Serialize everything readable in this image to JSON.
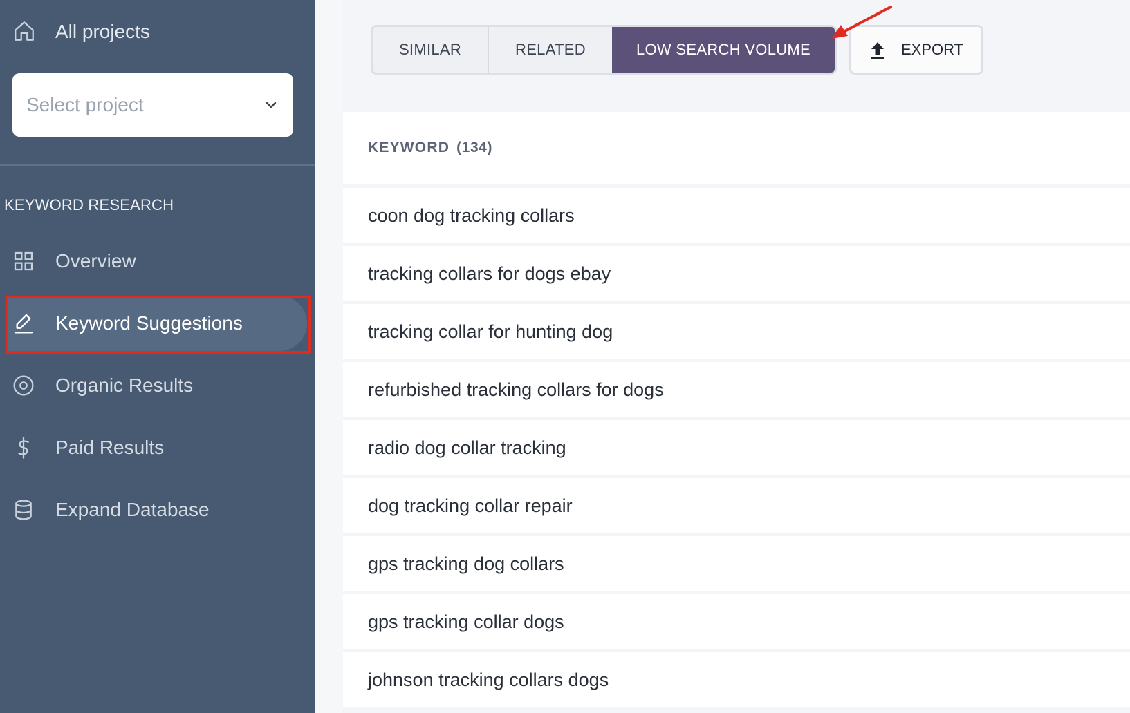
{
  "sidebar": {
    "all_projects_label": "All projects",
    "project_select_placeholder": "Select project",
    "section_title": "KEYWORD RESEARCH",
    "items": [
      {
        "label": "Overview",
        "icon": "grid-icon"
      },
      {
        "label": "Keyword Suggestions",
        "icon": "pencil-icon",
        "active": true
      },
      {
        "label": "Organic Results",
        "icon": "target-icon"
      },
      {
        "label": "Paid Results",
        "icon": "dollar-icon"
      },
      {
        "label": "Expand Database",
        "icon": "database-icon"
      }
    ]
  },
  "tabs": [
    {
      "label": "SIMILAR"
    },
    {
      "label": "RELATED"
    },
    {
      "label": "LOW SEARCH VOLUME",
      "active": true
    }
  ],
  "export_label": "EXPORT",
  "table": {
    "header_label": "KEYWORD",
    "header_count": "(134)",
    "rows": [
      "coon dog tracking collars",
      "tracking collars for dogs ebay",
      "tracking collar for hunting dog",
      "refurbished tracking collars for dogs",
      "radio dog collar tracking",
      "dog tracking collar repair",
      "gps tracking dog collars",
      "gps tracking collar dogs",
      "johnson tracking collars dogs"
    ]
  },
  "colors": {
    "sidebar_bg": "#475a72",
    "active_tab_bg": "#5c5178",
    "highlight": "#e22b20"
  }
}
